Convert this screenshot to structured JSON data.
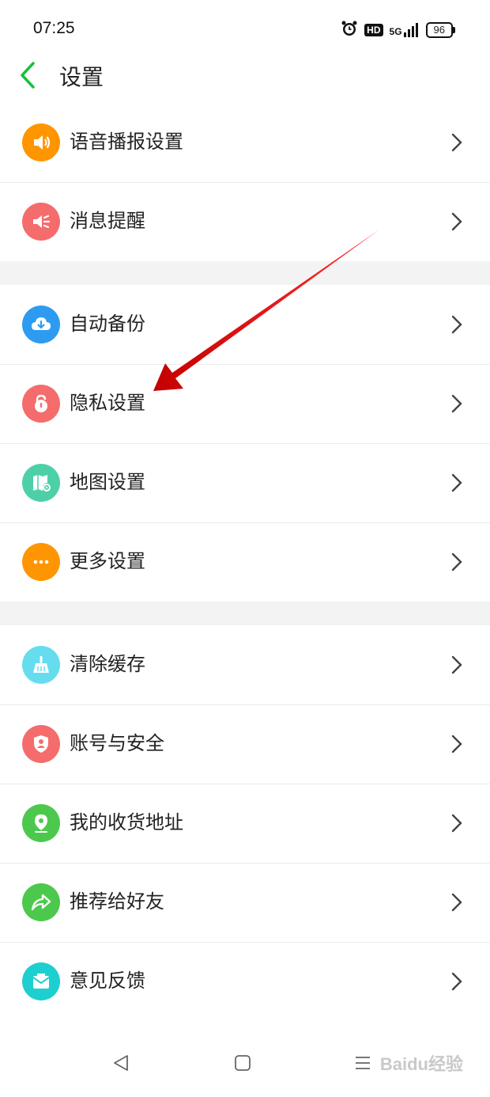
{
  "status_bar": {
    "time": "07:25",
    "hd": "HD",
    "network": "5G",
    "battery": "96"
  },
  "header": {
    "title": "设置"
  },
  "sections": [
    [
      {
        "label": "语音播报设置",
        "icon": "speaker-icon",
        "color": "#FF9500"
      },
      {
        "label": "消息提醒",
        "icon": "megaphone-icon",
        "color": "#F56C6C"
      }
    ],
    [
      {
        "label": "自动备份",
        "icon": "cloud-download-icon",
        "color": "#2D9CF0"
      },
      {
        "label": "隐私设置",
        "icon": "lock-icon",
        "color": "#F56C6C"
      },
      {
        "label": "地图设置",
        "icon": "map-gear-icon",
        "color": "#4DD0A7"
      },
      {
        "label": "更多设置",
        "icon": "more-dots-icon",
        "color": "#FF9500"
      }
    ],
    [
      {
        "label": "清除缓存",
        "icon": "broom-icon",
        "color": "#66DDEE"
      },
      {
        "label": "账号与安全",
        "icon": "shield-user-icon",
        "color": "#F56C6C"
      },
      {
        "label": "我的收货地址",
        "icon": "location-pin-icon",
        "color": "#4CC94C"
      },
      {
        "label": "推荐给好友",
        "icon": "share-arrow-icon",
        "color": "#4CC94C"
      },
      {
        "label": "意见反馈",
        "icon": "mail-icon",
        "color": "#1ECFCF"
      }
    ]
  ],
  "annotation": {
    "type": "red-arrow",
    "points_to": "隐私设置",
    "color": "#E8151B"
  },
  "nav": {
    "back": "back-triangle-icon",
    "home": "home-square-icon",
    "menu": "menu-lines-icon"
  },
  "watermark": "Baidu经验"
}
